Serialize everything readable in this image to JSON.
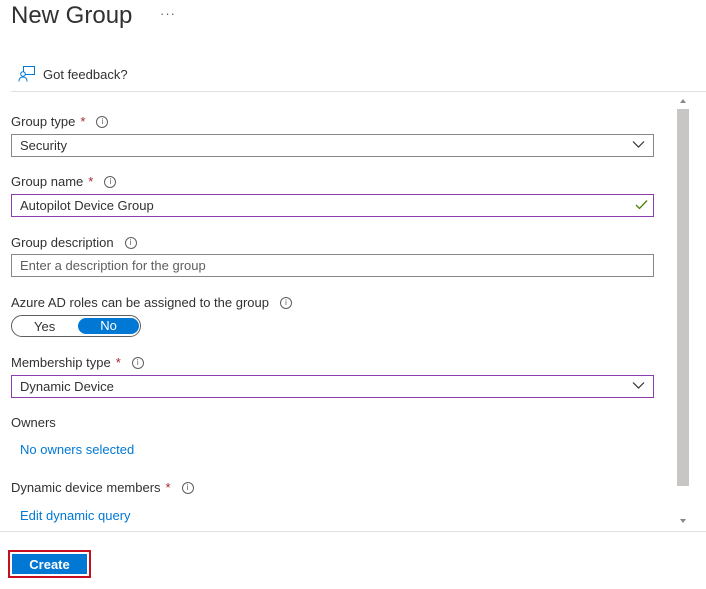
{
  "header": {
    "title": "New Group",
    "more_label": "···"
  },
  "feedback": {
    "label": "Got feedback?"
  },
  "form": {
    "group_type": {
      "label": "Group type",
      "required": "*",
      "value": "Security"
    },
    "group_name": {
      "label": "Group name",
      "required": "*",
      "value": "Autopilot Device Group"
    },
    "group_description": {
      "label": "Group description",
      "placeholder": "Enter a description for the group"
    },
    "azure_ad_roles": {
      "label": "Azure AD roles can be assigned to the group",
      "options": [
        "Yes",
        "No"
      ],
      "selected": "No"
    },
    "membership_type": {
      "label": "Membership type",
      "required": "*",
      "value": "Dynamic Device"
    },
    "owners": {
      "label": "Owners",
      "link": "No owners selected"
    },
    "dynamic_members": {
      "label": "Dynamic device members",
      "required": "*",
      "link": "Edit dynamic query"
    }
  },
  "footer": {
    "create_label": "Create"
  },
  "colors": {
    "accent": "#0078d4",
    "required": "#a4262c",
    "highlight_border": "#c50f1f",
    "focus_border": "#8a3fb0",
    "check": "#498205"
  },
  "icons": {
    "feedback": "feedback-person-icon",
    "info": "info-icon",
    "chevron": "chevron-down-icon",
    "check": "checkmark-icon"
  }
}
